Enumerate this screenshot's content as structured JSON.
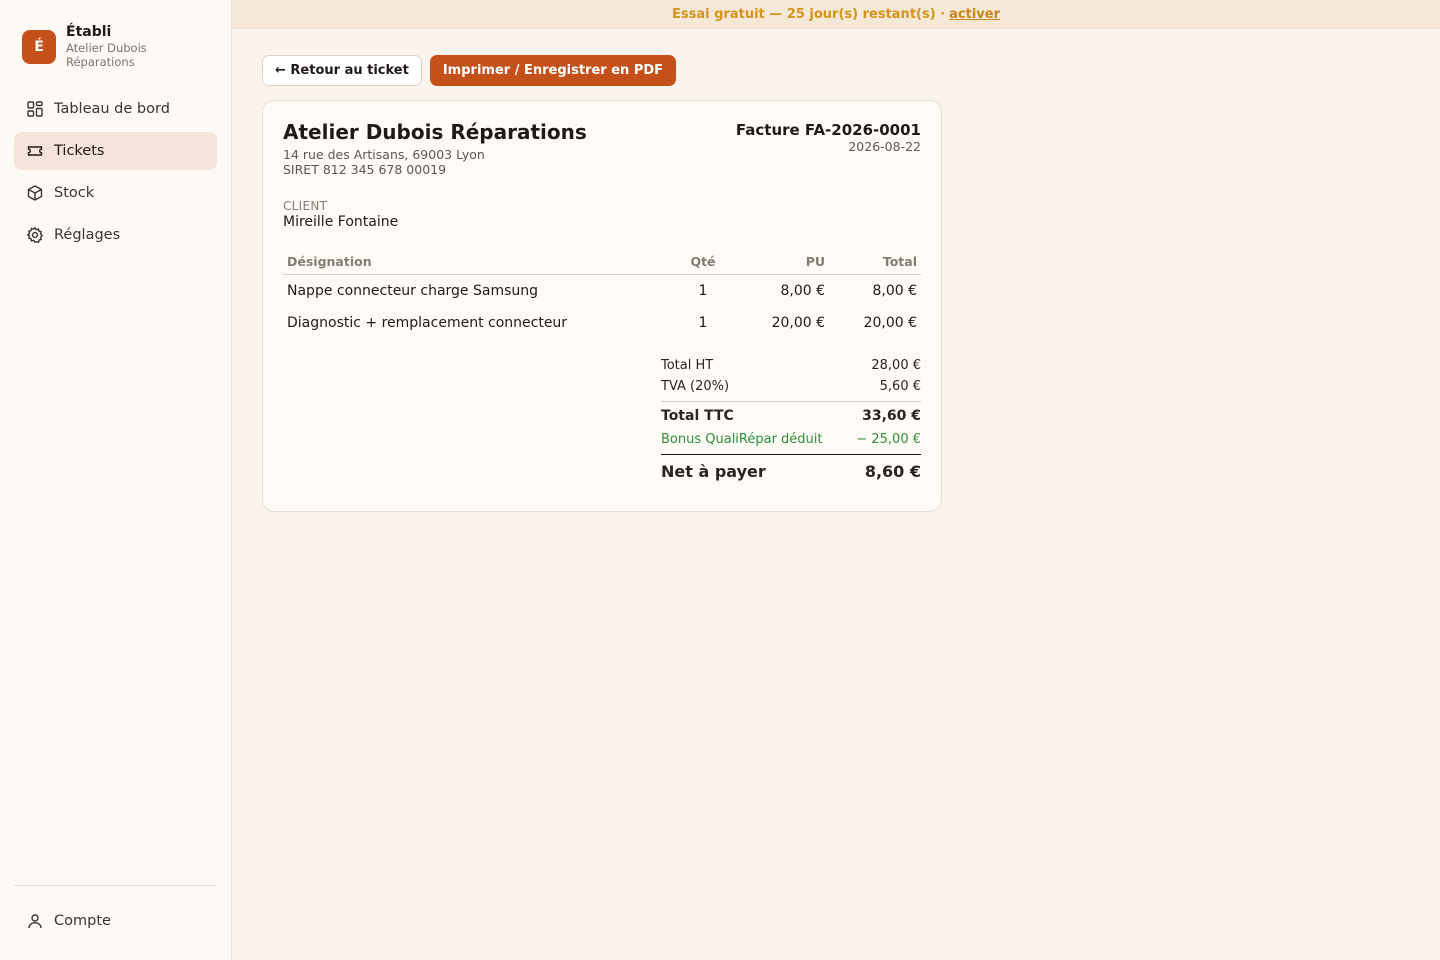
{
  "banner": {
    "text": "Essai gratuit — 25 jour(s) restant(s) ·",
    "link": "activer"
  },
  "brand": {
    "logo_letter": "É",
    "name": "Établi",
    "subtitle": "Atelier Dubois Réparations"
  },
  "sidebar": {
    "items": [
      {
        "label": "Tableau de bord",
        "icon": "dashboard-icon",
        "active": false
      },
      {
        "label": "Tickets",
        "icon": "ticket-icon",
        "active": true
      },
      {
        "label": "Stock",
        "icon": "box-icon",
        "active": false
      },
      {
        "label": "Réglages",
        "icon": "gear-icon",
        "active": false
      }
    ],
    "account": {
      "label": "Compte",
      "icon": "user-icon"
    }
  },
  "actions": {
    "back_label": "← Retour au ticket",
    "print_label": "Imprimer / Enregistrer en PDF"
  },
  "invoice": {
    "company_name": "Atelier Dubois Réparations",
    "address": "14 rue des Artisans, 69003 Lyon",
    "siret": "SIRET 812 345 678 00019",
    "number": "Facture FA-2026-0001",
    "date": "2026-08-22",
    "client_label": "CLIENT",
    "client_name": "Mireille Fontaine",
    "columns": {
      "designation": "Désignation",
      "qty": "Qté",
      "unit_price": "PU",
      "total": "Total"
    },
    "lines": [
      {
        "designation": "Nappe connecteur charge Samsung",
        "qty": "1",
        "unit_price": "8,00 €",
        "total": "8,00 €"
      },
      {
        "designation": "Diagnostic + remplacement connecteur",
        "qty": "1",
        "unit_price": "20,00 €",
        "total": "20,00 €"
      }
    ],
    "totals": {
      "ht_label": "Total HT",
      "ht_value": "28,00 €",
      "tva_label": "TVA (20%)",
      "tva_value": "5,60 €",
      "ttc_label": "Total TTC",
      "ttc_value": "33,60 €",
      "bonus_label": "Bonus QualiRépar déduit",
      "bonus_value": "− 25,00 €",
      "net_label": "Net à payer",
      "net_value": "8,60 €"
    }
  },
  "colors": {
    "accent": "#c4511a",
    "banner_bg": "#f6e8d6",
    "banner_text": "#d4931a",
    "bonus": "#2f8f3a"
  }
}
